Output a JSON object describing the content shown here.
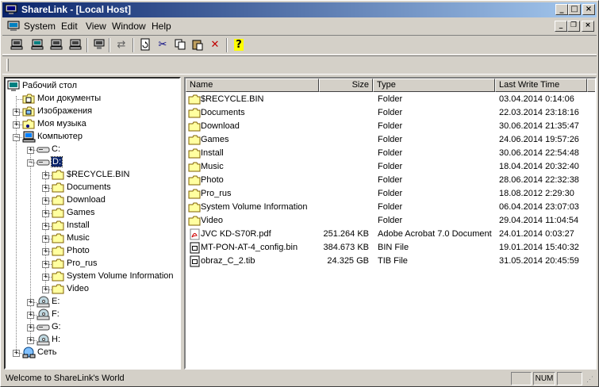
{
  "window": {
    "title": "ShareLink - [Local Host]",
    "colors": {
      "titlebar_start": "#0a246a",
      "titlebar_end": "#a6caf0",
      "face": "#d4d0c8",
      "selection": "#0a246a",
      "folder": "#ffffa0"
    }
  },
  "menu": {
    "items": [
      {
        "label": "System",
        "underline": "S"
      },
      {
        "label": "Edit",
        "underline": "E"
      },
      {
        "label": "View",
        "underline": "V"
      },
      {
        "label": "Window",
        "underline": "W"
      },
      {
        "label": "Help",
        "underline": "H"
      }
    ]
  },
  "toolbar": {
    "buttons": [
      {
        "icon": "computer-icon"
      },
      {
        "icon": "connect-computer-icon"
      },
      {
        "icon": "computer-icon"
      },
      {
        "icon": "computer-icon"
      },
      {
        "icon": "network-computer-icon"
      },
      {
        "icon": "transfer-arrows-icon"
      },
      {
        "icon": "refresh-icon"
      },
      {
        "icon": "cut-icon"
      },
      {
        "icon": "copy-icon"
      },
      {
        "icon": "paste-icon"
      },
      {
        "icon": "delete-icon"
      },
      {
        "icon": "help-icon"
      }
    ]
  },
  "tree": {
    "nodes": [
      {
        "label": "Рабочий стол",
        "icon": "desktop-icon",
        "level": 0,
        "expander": ""
      },
      {
        "label": "Мои документы",
        "icon": "my-documents-icon",
        "level": 1,
        "expander": ""
      },
      {
        "label": "Изображения",
        "icon": "pictures-icon",
        "level": 1,
        "expander": "+"
      },
      {
        "label": "Моя музыка",
        "icon": "music-icon",
        "level": 1,
        "expander": "+"
      },
      {
        "label": "Компьютер",
        "icon": "computer-icon",
        "level": 1,
        "expander": "-"
      },
      {
        "label": "C:",
        "icon": "drive-icon",
        "level": 2,
        "expander": "+"
      },
      {
        "label": "D:",
        "icon": "drive-icon",
        "level": 2,
        "expander": "-",
        "selected": true
      },
      {
        "label": "$RECYCLE.BIN",
        "icon": "folder-icon",
        "level": 3,
        "expander": "+"
      },
      {
        "label": "Documents",
        "icon": "folder-icon",
        "level": 3,
        "expander": "+"
      },
      {
        "label": "Download",
        "icon": "folder-icon",
        "level": 3,
        "expander": "+"
      },
      {
        "label": "Games",
        "icon": "folder-icon",
        "level": 3,
        "expander": "+"
      },
      {
        "label": "Install",
        "icon": "folder-icon",
        "level": 3,
        "expander": "+"
      },
      {
        "label": "Music",
        "icon": "folder-icon",
        "level": 3,
        "expander": "+"
      },
      {
        "label": "Photo",
        "icon": "folder-icon",
        "level": 3,
        "expander": "+"
      },
      {
        "label": "Pro_rus",
        "icon": "folder-icon",
        "level": 3,
        "expander": "+"
      },
      {
        "label": "System Volume Information",
        "icon": "folder-icon",
        "level": 3,
        "expander": "+"
      },
      {
        "label": "Video",
        "icon": "folder-icon",
        "level": 3,
        "expander": "+"
      },
      {
        "label": "E:",
        "icon": "cd-drive-icon",
        "level": 2,
        "expander": "+"
      },
      {
        "label": "F:",
        "icon": "cd-drive-icon",
        "level": 2,
        "expander": "+"
      },
      {
        "label": "G:",
        "icon": "drive-icon",
        "level": 2,
        "expander": "+"
      },
      {
        "label": "H:",
        "icon": "cd-drive-icon",
        "level": 2,
        "expander": "+"
      },
      {
        "label": "Сеть",
        "icon": "network-icon",
        "level": 1,
        "expander": "+"
      }
    ]
  },
  "list": {
    "columns": [
      "Name",
      "Size",
      "Type",
      "Last Write Time"
    ],
    "rows": [
      {
        "name": "$RECYCLE.BIN",
        "size": "",
        "type": "Folder",
        "time": "03.04.2014 0:14:06",
        "icon": "folder-icon"
      },
      {
        "name": "Documents",
        "size": "",
        "type": "Folder",
        "time": "22.03.2014 23:18:16",
        "icon": "folder-icon"
      },
      {
        "name": "Download",
        "size": "",
        "type": "Folder",
        "time": "30.06.2014 21:35:47",
        "icon": "folder-icon"
      },
      {
        "name": "Games",
        "size": "",
        "type": "Folder",
        "time": "24.06.2014 19:57:26",
        "icon": "folder-icon"
      },
      {
        "name": "Install",
        "size": "",
        "type": "Folder",
        "time": "30.06.2014 22:54:48",
        "icon": "folder-icon"
      },
      {
        "name": "Music",
        "size": "",
        "type": "Folder",
        "time": "18.04.2014 20:32:40",
        "icon": "folder-icon"
      },
      {
        "name": "Photo",
        "size": "",
        "type": "Folder",
        "time": "28.06.2014 22:32:38",
        "icon": "folder-icon"
      },
      {
        "name": "Pro_rus",
        "size": "",
        "type": "Folder",
        "time": "18.08.2012 2:29:30",
        "icon": "folder-icon"
      },
      {
        "name": "System Volume Information",
        "size": "",
        "type": "Folder",
        "time": "06.04.2014 23:07:03",
        "icon": "folder-icon"
      },
      {
        "name": "Video",
        "size": "",
        "type": "Folder",
        "time": "29.04.2014 11:04:54",
        "icon": "folder-icon"
      },
      {
        "name": "JVC KD-S70R.pdf",
        "size": "251.264 KB",
        "type": "Adobe Acrobat 7.0 Document",
        "time": "24.01.2014 0:03:27",
        "icon": "pdf-file-icon"
      },
      {
        "name": "MT-PON-AT-4_config.bin",
        "size": "384.673 KB",
        "type": "BIN File",
        "time": "19.01.2014 15:40:32",
        "icon": "binary-file-icon"
      },
      {
        "name": "obraz_C_2.tib",
        "size": "24.325 GB",
        "type": "TIB File",
        "time": "31.05.2014 20:45:59",
        "icon": "binary-file-icon"
      }
    ]
  },
  "status": {
    "text": "Welcome to ShareLink's World",
    "num": "NUM"
  }
}
